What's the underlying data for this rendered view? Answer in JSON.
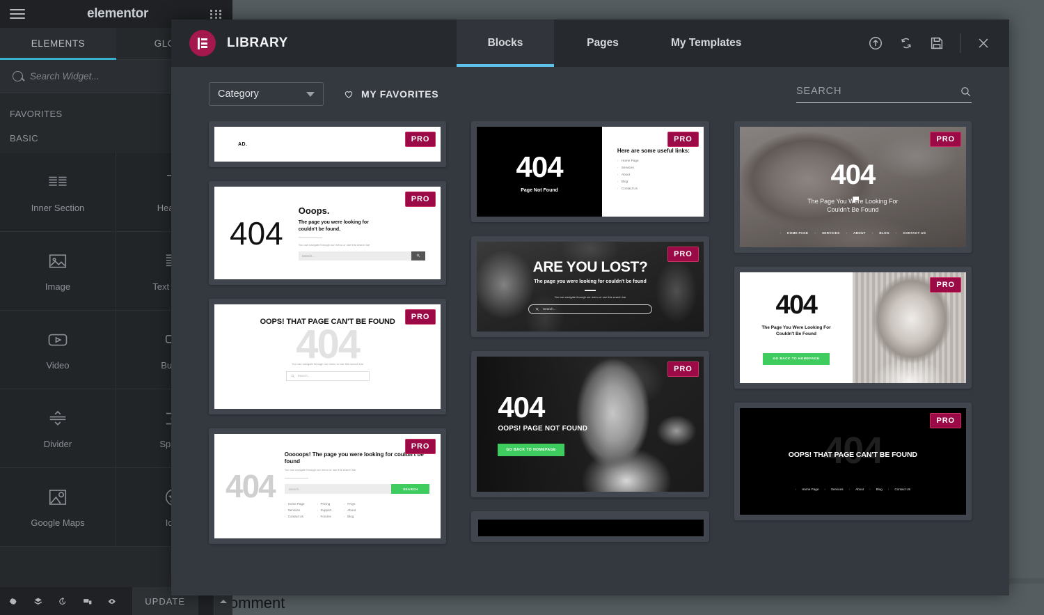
{
  "editor": {
    "logo": "elementor",
    "menu_icon": "hamburger-icon",
    "apps_icon": "grid-icon",
    "tabs": [
      {
        "label": "ELEMENTS",
        "active": true
      },
      {
        "label": "GLOBAL",
        "active": false
      }
    ],
    "search_placeholder": "Search Widget...",
    "sections": [
      {
        "title": "FAVORITES"
      },
      {
        "title": "BASIC"
      }
    ],
    "widgets": [
      {
        "label": "Inner Section",
        "icon": "inner-section-icon"
      },
      {
        "label": "Heading",
        "icon": "heading-icon"
      },
      {
        "label": "Image",
        "icon": "image-icon"
      },
      {
        "label": "Text Editor",
        "icon": "text-editor-icon"
      },
      {
        "label": "Video",
        "icon": "video-icon"
      },
      {
        "label": "Button",
        "icon": "button-icon"
      },
      {
        "label": "Divider",
        "icon": "divider-icon"
      },
      {
        "label": "Spacer",
        "icon": "spacer-icon"
      },
      {
        "label": "Google Maps",
        "icon": "google-maps-icon"
      },
      {
        "label": "Icon",
        "icon": "star-icon"
      }
    ],
    "footer": {
      "icons": [
        "settings-icon",
        "navigator-icon",
        "history-icon",
        "responsive-mode-icon",
        "preview-icon"
      ],
      "update_label": "UPDATE",
      "caret": "chevron-up-icon"
    },
    "canvas_text": "Comment"
  },
  "modal": {
    "title": "LIBRARY",
    "logo_icon": "elementor-logo-icon",
    "tabs": [
      {
        "label": "Blocks",
        "active": true
      },
      {
        "label": "Pages",
        "active": false
      },
      {
        "label": "My Templates",
        "active": false
      }
    ],
    "actions": [
      {
        "name": "upload-template-icon",
        "title": "Import Template"
      },
      {
        "name": "sync-library-icon",
        "title": "Sync Library"
      },
      {
        "name": "save-template-icon",
        "title": "Save"
      },
      {
        "name": "close-icon",
        "title": "Close"
      }
    ],
    "toolbar": {
      "category_label": "Category",
      "favorites_label": "MY FAVORITES",
      "favorites_icon": "heart-icon",
      "search_placeholder": "SEARCH",
      "search_value": "",
      "search_icon": "search-icon"
    },
    "badge_label": "PRO",
    "accent_color": "#5fc1e8",
    "brand_color": "#a4184e",
    "pro_badge_color": "#9b0a46",
    "cta_green": "#3fcc5e"
  },
  "templates": {
    "column1": [
      {
        "id": "ad-bar",
        "type": "ad-bar",
        "badge": "PRO",
        "text": "AD."
      },
      {
        "id": "404-ooops",
        "type": "split-text",
        "badge": "PRO",
        "code": "404",
        "heading": "Ooops.",
        "subheading": "The page you were looking for\ncouldn't be found.",
        "paragraph": "You can navigate through our menu or use this search bar",
        "search_placeholder": "Search..."
      },
      {
        "id": "404-ghost-light",
        "type": "ghost-404",
        "badge": "PRO",
        "code": "404",
        "heading": "OOPS! THAT PAGE CAN'T BE FOUND",
        "paragraph": "You can navigate through our menu or use this search bar",
        "search_placeholder": "Search..."
      },
      {
        "id": "404-ghost-links",
        "type": "ghost-404-links",
        "badge": "PRO",
        "code": "404",
        "heading": "Ooooops! The page you were looking for couldn't be found",
        "paragraph": "You can navigate through our menu or use this search bar",
        "search_placeholder": "Search...",
        "button": "SEARCH",
        "links": [
          [
            "Home Page",
            "Services",
            "Contact Us"
          ],
          [
            "Pricing",
            "Support",
            "Forums"
          ],
          [
            "FAQs",
            "About",
            "Blog"
          ]
        ]
      }
    ],
    "column2": [
      {
        "id": "404-black-links",
        "type": "split-black",
        "badge": "PRO",
        "code": "404",
        "subheading": "Page Not Found",
        "heading": "Here are some useful links:",
        "links": [
          "Home Page",
          "Services",
          "About",
          "Blog",
          "Contact Us"
        ]
      },
      {
        "id": "are-you-lost",
        "type": "photo-hero",
        "badge": "PRO",
        "heading": "ARE YOU LOST?",
        "subheading": "The page you were looking for couldn't be found",
        "paragraph": "You can navigate through our menu or use this search bar",
        "search_placeholder": "Search..."
      },
      {
        "id": "404-man-photo",
        "type": "photo-cta",
        "badge": "PRO",
        "code": "404",
        "subheading": "OOPS! PAGE NOT FOUND",
        "button": "GO BACK TO HOMEPAGE"
      },
      {
        "id": "partial-black-card",
        "type": "partial",
        "badge": ""
      }
    ],
    "column3": [
      {
        "id": "404-keyboard",
        "type": "photo-hero-nav",
        "badge": "PRO",
        "code": "404",
        "subheading": "The Page You Were Looking For\nCouldn't Be Found",
        "nav": [
          "HOME PAGE",
          "SERVICES",
          "ABOUT",
          "BLOG",
          "CONTACT US"
        ]
      },
      {
        "id": "404-baby-split",
        "type": "split-photo",
        "badge": "PRO",
        "code": "404",
        "subheading": "The Page You Were Looking For\nCouldn't Be Found",
        "button": "GO BACK TO HOMEPAGE"
      },
      {
        "id": "404-ghost-dark",
        "type": "ghost-404-dark",
        "badge": "PRO",
        "code": "404",
        "heading": "OOPS! THAT PAGE CAN'T BE FOUND",
        "nav": [
          "Home Page",
          "Services",
          "About",
          "Blog",
          "Contact Us"
        ]
      }
    ]
  }
}
